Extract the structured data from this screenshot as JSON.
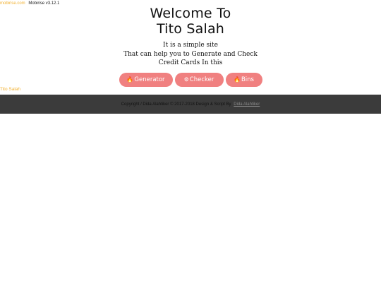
{
  "topbar": {
    "brand_link": "mobirise.com",
    "version": "Mobirise v3.12.1"
  },
  "hero": {
    "title_line1": "Welcome To",
    "title_line2": "Tito Salah",
    "desc_line1": "It is a simple site",
    "desc_line2": "That can help you to Generate and Check",
    "desc_line3": "Credit Cards In this"
  },
  "buttons": {
    "generator": "Generator",
    "checker": "Checker",
    "bins": "Bins"
  },
  "icons": {
    "generator": "fire-icon",
    "checker": "gear-icon",
    "bins": "fire-icon"
  },
  "brand_link": "Tito Salah",
  "footer": {
    "copyright": "Copyright / Dida Alahtiker © 2017-2018 Design & Script By",
    "author": "Dida Alahtiker"
  },
  "colors": {
    "button": "#f08080",
    "link": "#f2b233",
    "footer_bg": "#3b3b3b"
  }
}
